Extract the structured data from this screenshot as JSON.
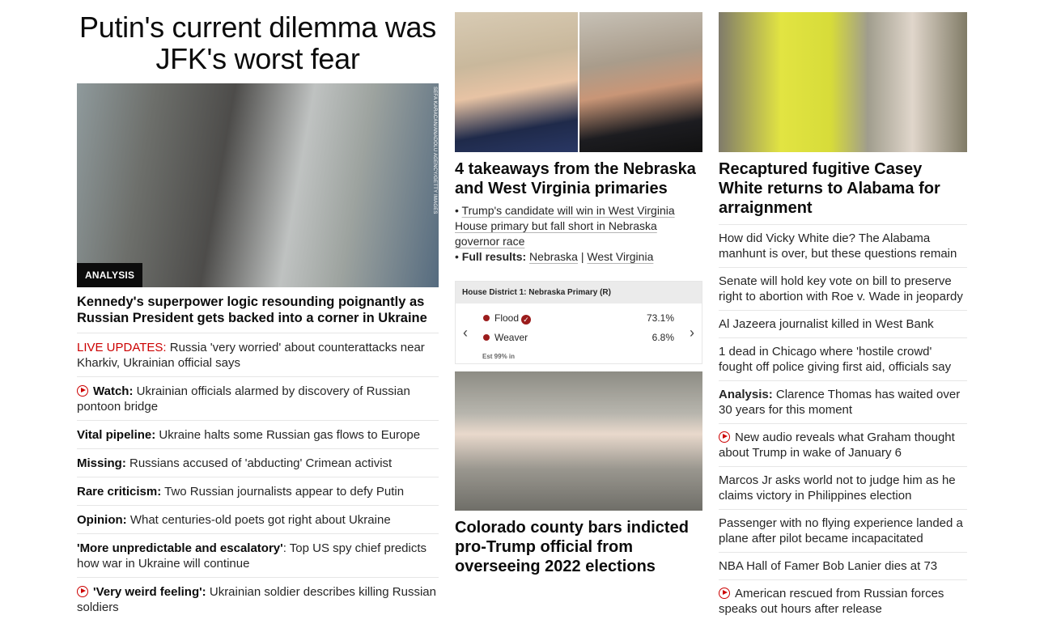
{
  "col1": {
    "title": "Putin's current dilemma was JFK's worst fear",
    "image_credit": "SEFA KARACAN/ANADOLU AGENCY/GETTY IMAGES",
    "badge": "ANALYSIS",
    "headline": "Kennedy's superpower logic resounding poignantly as Russian President gets backed into a corner in Ukraine",
    "stories": [
      {
        "prefix": "LIVE UPDATES:",
        "text": " Russia 'very worried' about counterattacks near Kharkiv, Ukrainian official says"
      },
      {
        "prefix": "Watch:",
        "text": " Ukrainian officials alarmed by discovery of Russian pontoon bridge"
      },
      {
        "prefix": "Vital pipeline:",
        "text": " Ukraine halts some Russian gas flows to Europe"
      },
      {
        "prefix": "Missing:",
        "text": " Russians accused of 'abducting' Crimean activist"
      },
      {
        "prefix": "Rare criticism:",
        "text": " Two Russian journalists appear to defy Putin"
      },
      {
        "prefix": "Opinion:",
        "text": " What centuries-old poets got right about Ukraine"
      },
      {
        "prefix": "'More unpredictable and escalatory'",
        "text": ": Top US spy chief predicts how war in Ukraine will continue"
      },
      {
        "prefix": "'Very weird feeling':",
        "text": " Ukrainian soldier describes killing Russian soldiers"
      }
    ]
  },
  "col2": {
    "headline": "4 takeaways from the Nebraska and West Virginia primaries",
    "bullet1": "Trump's candidate will win in West Virginia House primary but fall short in Nebraska governor race",
    "bullet2_label": "Full results:",
    "bullet2_link1": "Nebraska",
    "bullet2_sep": "|",
    "bullet2_link2": "West Virginia",
    "widget": {
      "header": "House District 1: Nebraska Primary (R)",
      "rows": [
        {
          "name": "Flood",
          "pct": "73.1%"
        },
        {
          "name": "Weaver",
          "pct": "6.8%"
        }
      ],
      "est": "Est 99% in",
      "check": "✓",
      "arrow_left": "‹",
      "arrow_right": "›"
    },
    "headline2": "Colorado county bars indicted pro-Trump official from overseeing 2022 elections"
  },
  "col3": {
    "headline": "Recaptured fugitive Casey White returns to Alabama for arraignment",
    "stories": [
      {
        "prefix": "",
        "text": "How did Vicky White die? The Alabama manhunt is over, but these questions remain"
      },
      {
        "prefix": "",
        "text": "Senate will hold key vote on bill to preserve right to abortion with Roe v. Wade in jeopardy"
      },
      {
        "prefix": "",
        "text": "Al Jazeera journalist killed in West Bank"
      },
      {
        "prefix": "",
        "text": "1 dead in Chicago where 'hostile crowd' fought off police giving first aid, officials say"
      },
      {
        "prefix": "Analysis:",
        "text": " Clarence Thomas has waited over 30 years for this moment"
      },
      {
        "prefix": "",
        "text": "New audio reveals what Graham thought about Trump in wake of January 6"
      },
      {
        "prefix": "",
        "text": "Marcos Jr asks world not to judge him as he claims victory in Philippines election"
      },
      {
        "prefix": "",
        "text": "Passenger with no flying experience landed a plane after pilot became incapacitated"
      },
      {
        "prefix": "",
        "text": "NBA Hall of Famer Bob Lanier dies at 73"
      },
      {
        "prefix": "",
        "text": "American rescued from Russian forces speaks out hours after release"
      }
    ]
  },
  "colors": {
    "live_red": "#cc0000",
    "gop_red": "#9b1c1c"
  },
  "icons": {
    "video": "play-circle-icon",
    "winner": "check-circle-icon",
    "prev": "chevron-left-icon",
    "next": "chevron-right-icon"
  }
}
